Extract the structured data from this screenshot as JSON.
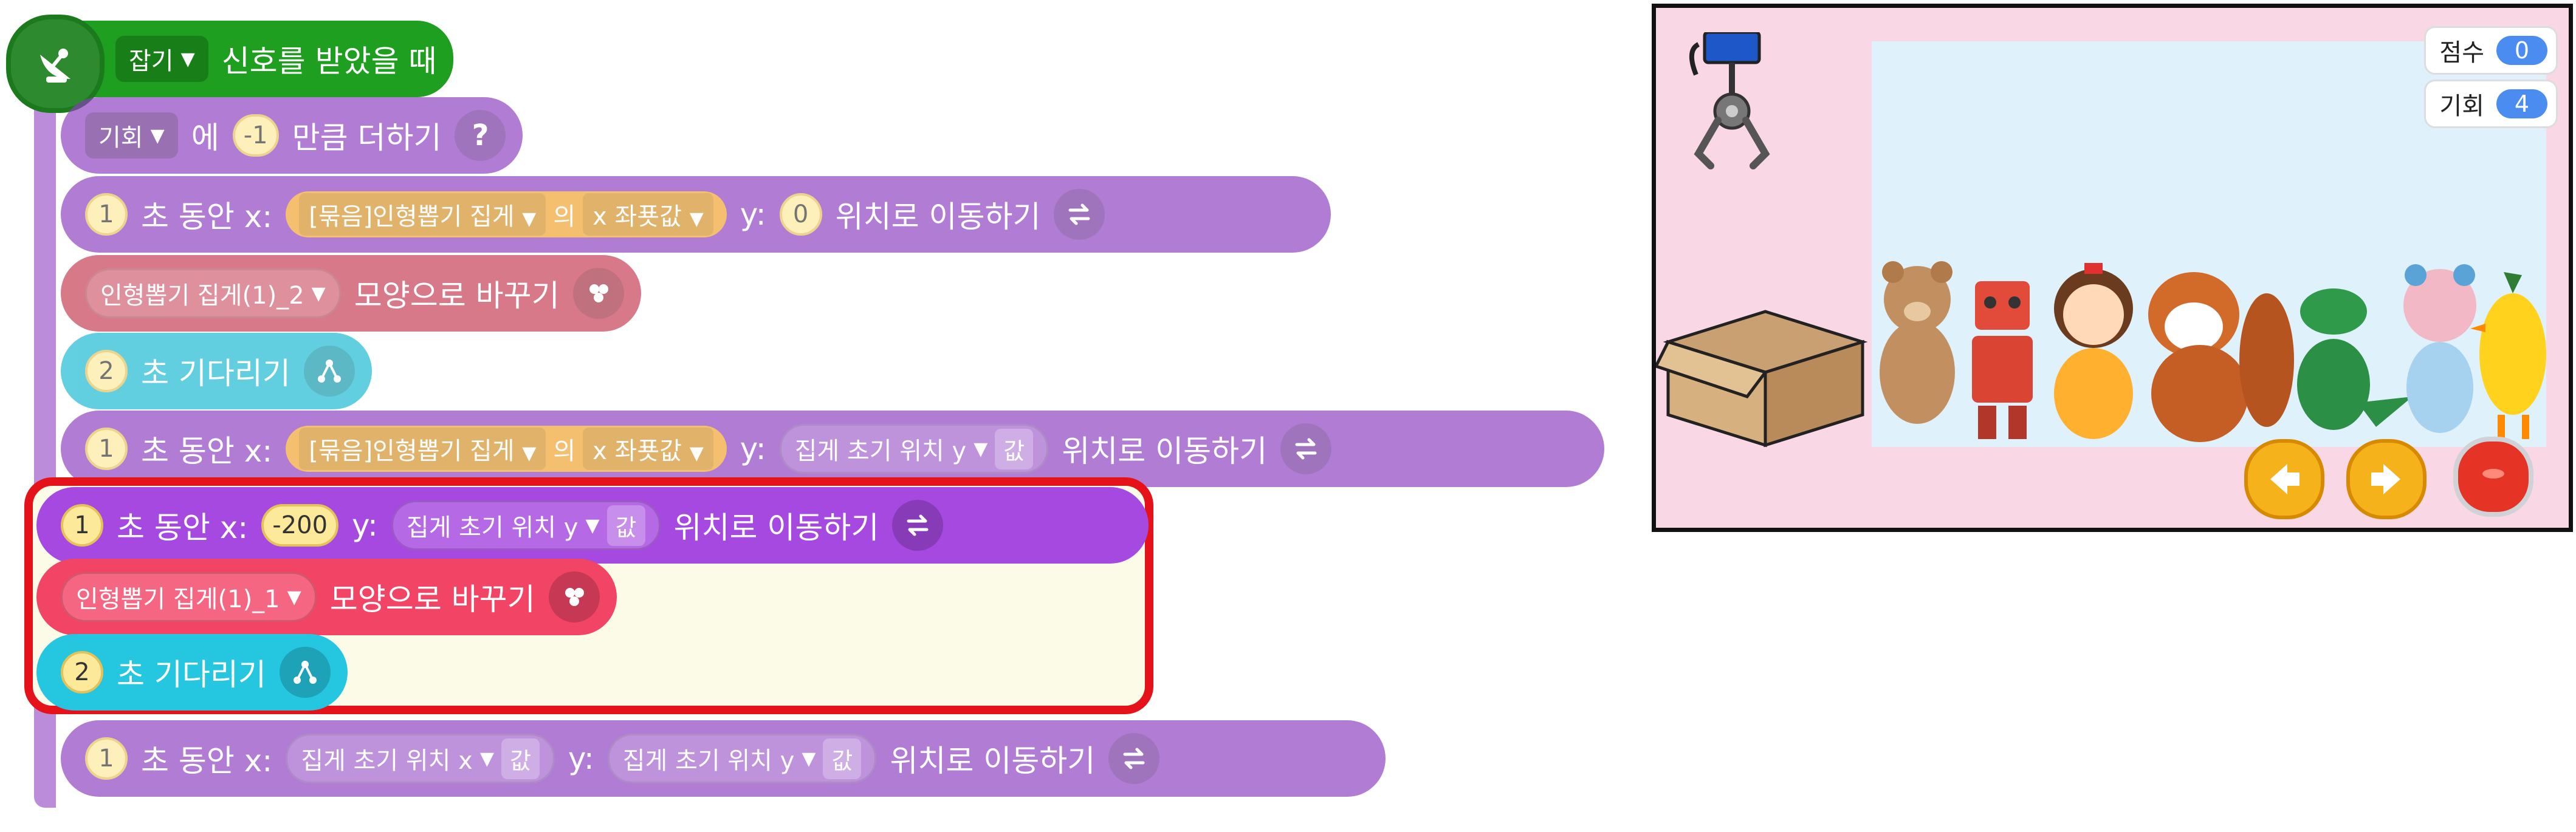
{
  "code": {
    "hat": {
      "signal_dropdown": "잡기",
      "label": "신호를 받았을 때"
    },
    "change_var": {
      "var_dropdown": "기회",
      "label_on": "에",
      "value": "-1",
      "label_action": "만큼 더하기",
      "help_glyph": "?"
    },
    "move1": {
      "seconds": "1",
      "label_sec_x": "초 동안 x:",
      "obj_dropdown": "[묶음]인형뽑기 집게",
      "of": "의",
      "prop_dropdown": "x 좌푯값",
      "label_y": "y:",
      "y_value": "0",
      "label_move": "위치로 이동하기"
    },
    "shape1": {
      "shape_dropdown": "인형뽑기 집게(1)_2",
      "label": "모양으로 바꾸기"
    },
    "wait1": {
      "seconds": "2",
      "label": "초 기다리기"
    },
    "move2": {
      "seconds": "1",
      "label_sec_x": "초 동안 x:",
      "obj_dropdown": "[묶음]인형뽑기 집게",
      "of": "의",
      "prop_dropdown": "x 좌푯값",
      "label_y": "y:",
      "var_dropdown": "집게 초기 위치 y",
      "value_tag": "값",
      "label_move": "위치로 이동하기"
    },
    "move3": {
      "seconds": "1",
      "label_sec_x": "초 동안 x:",
      "x_value": "-200",
      "label_y": "y:",
      "var_dropdown": "집게 초기 위치 y",
      "value_tag": "값",
      "label_move": "위치로 이동하기"
    },
    "shape2": {
      "shape_dropdown": "인형뽑기 집게(1)_1",
      "label": "모양으로 바꾸기"
    },
    "wait2": {
      "seconds": "2",
      "label": "초 기다리기"
    },
    "move4": {
      "seconds": "1",
      "label_sec_x": "초 동안 x:",
      "x_var_dropdown": "집게 초기 위치 x",
      "x_value_tag": "값",
      "label_y": "y:",
      "y_var_dropdown": "집게 초기 위치 y",
      "y_value_tag": "값",
      "label_move": "위치로 이동하기"
    }
  },
  "stage": {
    "score": {
      "label": "점수",
      "value": "0"
    },
    "chances": {
      "label": "기회",
      "value": "4"
    }
  },
  "icons": {
    "hat": "satellite-dish-icon",
    "help": "question-icon",
    "move": "swap-arrows-icon",
    "shape": "looks-blobs-icon",
    "wait": "flow-branch-icon",
    "left": "left-arrow-icon",
    "right": "right-arrow-icon",
    "stop": "red-button-icon"
  },
  "colors": {
    "motion": "#a649e0",
    "looks": "#f24566",
    "flow": "#24c6e0",
    "start": "#1f9f1f",
    "highlight": "#e6121a"
  }
}
